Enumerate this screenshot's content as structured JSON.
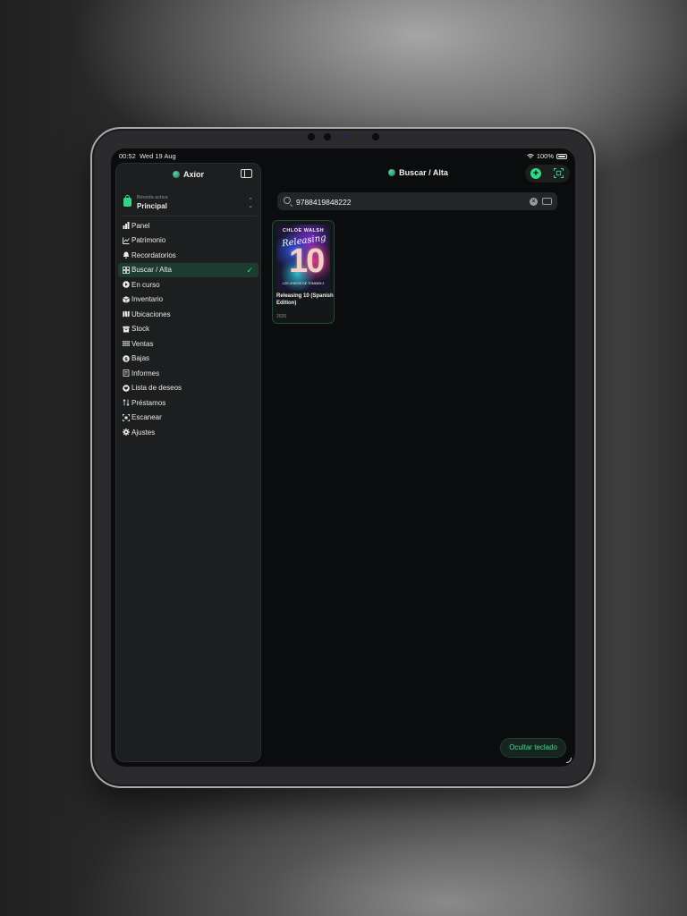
{
  "status_bar": {
    "time": "00:52",
    "date": "Wed 19 Aug",
    "battery": "100%"
  },
  "sidebar": {
    "app_title": "Axior",
    "vault_label": "Bóveda activa",
    "vault_name": "Principal",
    "items": [
      {
        "label": "Panel",
        "icon": "chart-bar-icon"
      },
      {
        "label": "Patrimonio",
        "icon": "trend-line-icon"
      },
      {
        "label": "Recordatorios",
        "icon": "bell-icon"
      },
      {
        "label": "Buscar / Alta",
        "icon": "grid-icon",
        "active": true
      },
      {
        "label": "En curso",
        "icon": "play-circle-icon"
      },
      {
        "label": "Inventario",
        "icon": "box-icon"
      },
      {
        "label": "Ubicaciones",
        "icon": "map-icon"
      },
      {
        "label": "Stock",
        "icon": "archive-icon"
      },
      {
        "label": "Ventas",
        "icon": "barcode-icon"
      },
      {
        "label": "Bajas",
        "icon": "coin-icon"
      },
      {
        "label": "Informes",
        "icon": "document-icon"
      },
      {
        "label": "Lista de deseos",
        "icon": "heart-icon"
      },
      {
        "label": "Préstamos",
        "icon": "arrows-icon"
      },
      {
        "label": "Escanear",
        "icon": "scan-icon"
      },
      {
        "label": "Ajustes",
        "icon": "gear-icon"
      }
    ]
  },
  "main": {
    "title": "Buscar / Alta",
    "search_value": "9788419848222",
    "result": {
      "cover_author": "CHLOE WALSH",
      "cover_script": "Releasing",
      "cover_number": "10",
      "cover_sub": "LOS CHICOS DE TOMMEN 3",
      "title": "Releasing 10 (Spanish Edition)",
      "year": "2026"
    },
    "hide_keyboard_label": "Ocultar teclado"
  },
  "colors": {
    "accent": "#2fd887",
    "active_bg": "#1d3b2e",
    "screen_bg": "#0b0c0d"
  }
}
